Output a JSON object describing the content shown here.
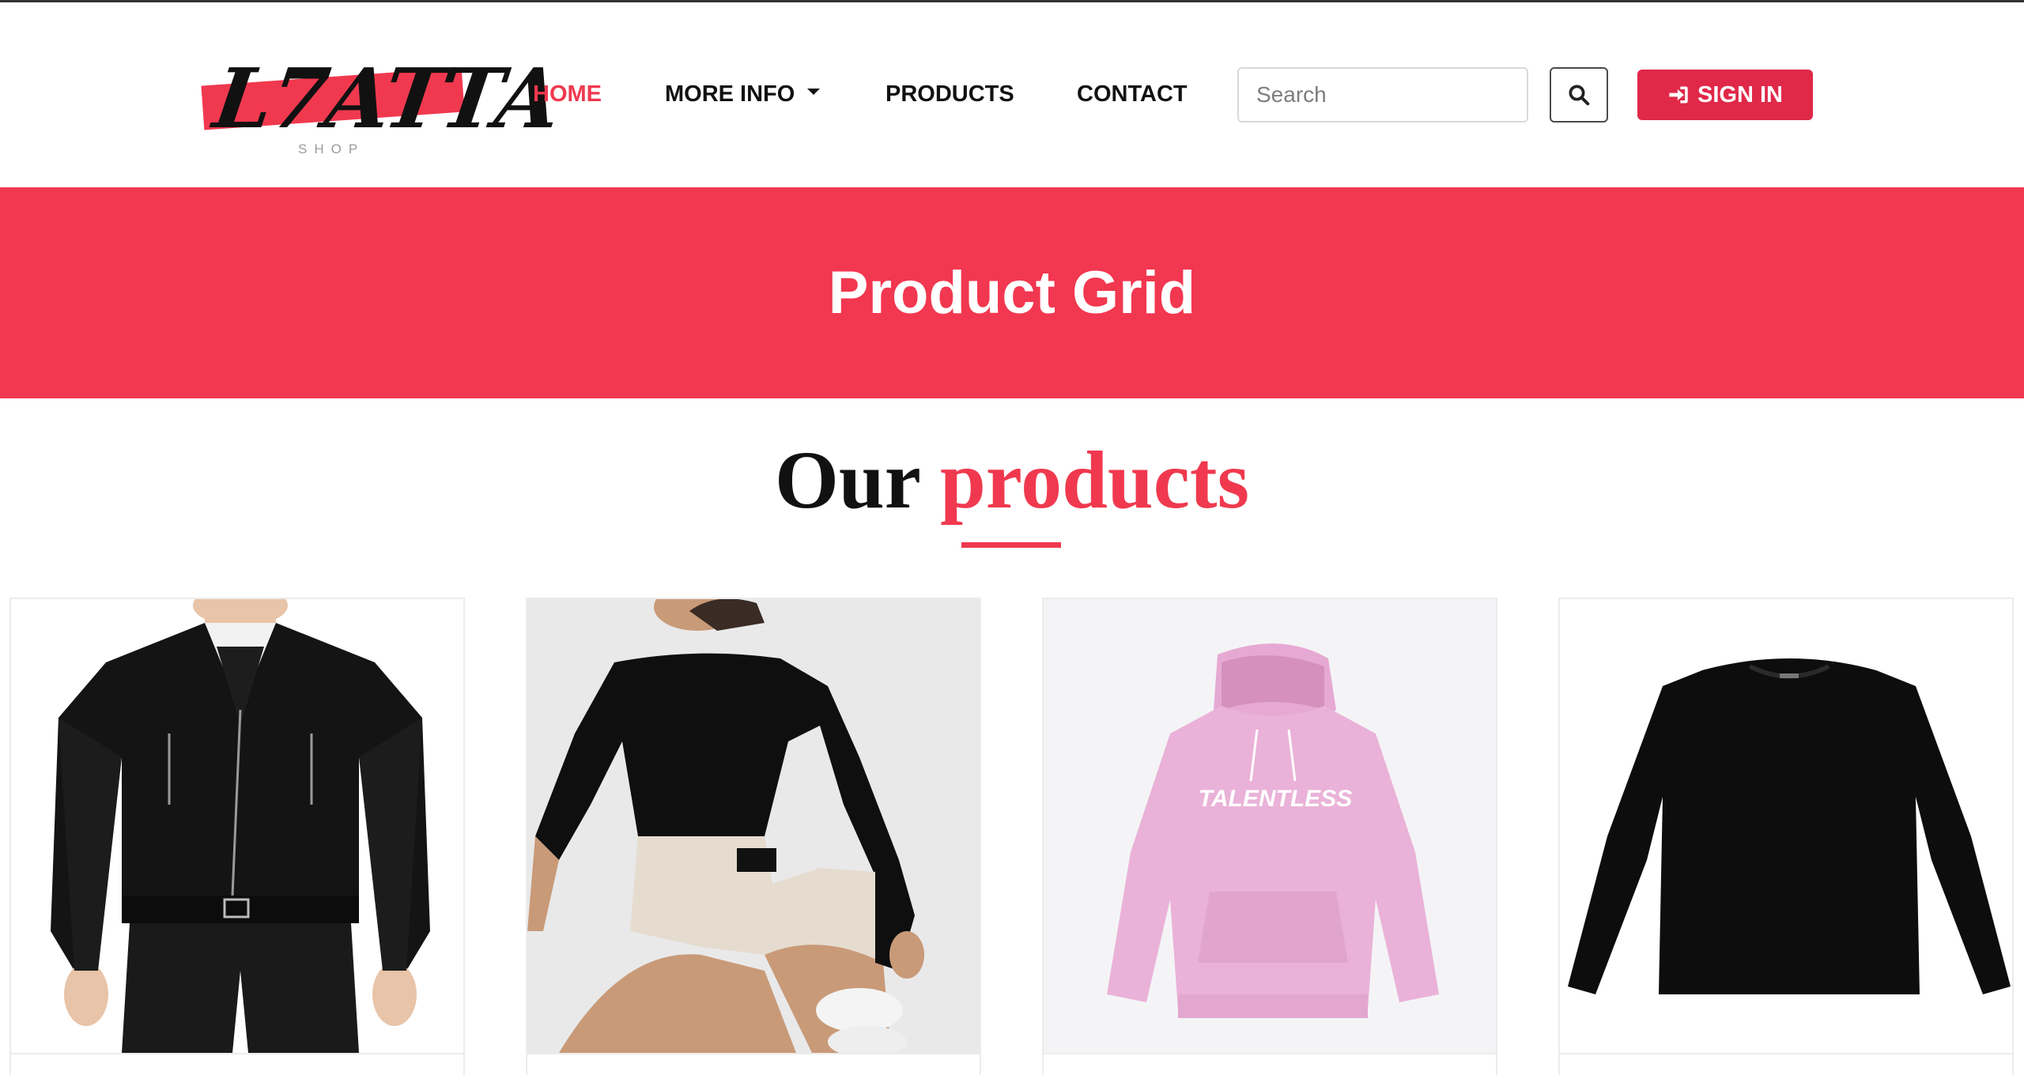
{
  "brand": {
    "logo_text": "L7ATTA",
    "logo_sub": "SHOP",
    "accent_color": "#f0394f"
  },
  "nav": {
    "items": [
      {
        "label": "HOME",
        "active": true
      },
      {
        "label": "MORE INFO",
        "dropdown": true
      },
      {
        "label": "PRODUCTS"
      },
      {
        "label": "CONTACT"
      }
    ]
  },
  "search": {
    "placeholder": "Search",
    "icon": "search-icon"
  },
  "signin": {
    "label": "SIGN IN",
    "icon": "sign-in-icon"
  },
  "banner": {
    "title": "Product Grid",
    "color": "#f23750"
  },
  "section": {
    "title_plain": "Our",
    "title_accent": "products"
  },
  "products": [
    {
      "name": "black leather jacket"
    },
    {
      "name": "black crop top"
    },
    {
      "name": "pink TALENTLESS hoodie",
      "print": "TALENTLESS"
    },
    {
      "name": "black long sleeve shirt"
    }
  ]
}
